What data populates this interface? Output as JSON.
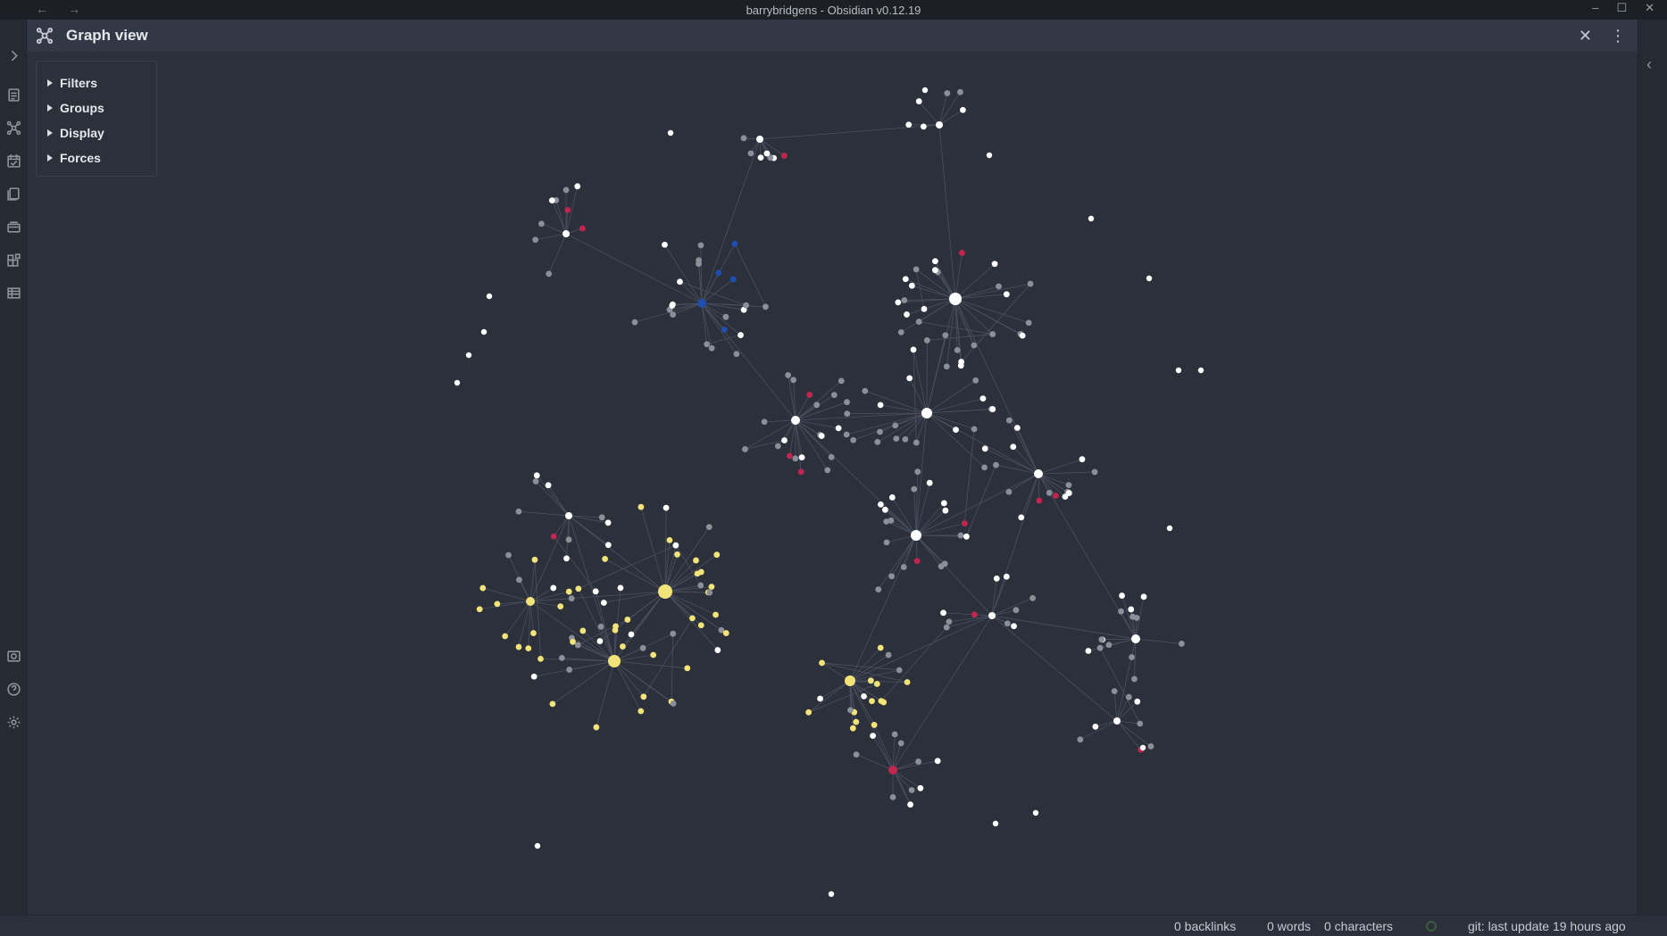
{
  "window": {
    "title": "barrybridgens - Obsidian v0.12.19",
    "nav_back": "←",
    "nav_forward": "→",
    "minimize": "–",
    "maximize": "☐",
    "close": "✕"
  },
  "pane": {
    "title": "Graph view",
    "close_glyph": "✕",
    "more_glyph": "⋮"
  },
  "controls": {
    "filters": "Filters",
    "groups": "Groups",
    "display": "Display",
    "forces": "Forces"
  },
  "ribbon": {
    "icons": [
      "open-quick-switcher-icon",
      "graph-view-icon",
      "daily-note-icon",
      "templates-icon",
      "slides-icon",
      "workspaces-icon",
      "tables-icon",
      "vault-switcher-icon",
      "help-icon",
      "settings-icon"
    ]
  },
  "status": {
    "backlinks": "0 backlinks",
    "words": "0 words",
    "characters": "0 characters",
    "git": "git: last update 19 hours ago"
  },
  "colors": {
    "background": "#2b303b",
    "node_default": "#8a8f98",
    "node_resolved": "#ffffff",
    "node_yellow": "#f2e479",
    "node_blue": "#1e4fb0",
    "node_red": "#c2264f",
    "edge": "#4a5060"
  }
}
